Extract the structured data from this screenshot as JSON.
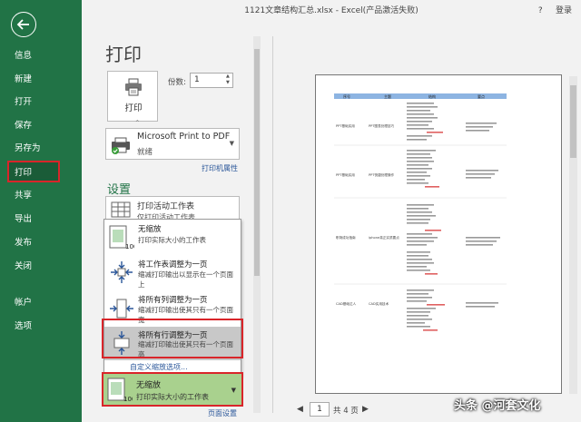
{
  "window": {
    "title": "1121文章结构汇总.xlsx - Excel(产品激活失败)",
    "help": "?",
    "login": "登录"
  },
  "nav": {
    "items": [
      "信息",
      "新建",
      "打开",
      "保存",
      "另存为",
      "打印",
      "共享",
      "导出",
      "发布",
      "关闭",
      "帐户",
      "选项"
    ],
    "active": "打印"
  },
  "print": {
    "title": "打印",
    "button_label": "打印",
    "copies_label": "份数:",
    "copies_value": "1"
  },
  "printer": {
    "name": "Microsoft Print to PDF",
    "status": "就绪",
    "properties_link": "打印机属性"
  },
  "settings": {
    "title": "设置",
    "active_sheets": {
      "label": "打印活动工作表",
      "sub": "仅打印活动工作表"
    },
    "scaling_menu": [
      {
        "title": "无缩放",
        "desc": "打印实际大小的工作表"
      },
      {
        "title": "将工作表调整为一页",
        "desc": "缩减打印输出以显示在一个页面上"
      },
      {
        "title": "将所有列调整为一页",
        "desc": "缩减打印输出使其只有一个页面宽"
      },
      {
        "title": "将所有行调整为一页",
        "desc": "缩减打印输出使其只有一个页面高"
      }
    ],
    "custom_scaling_link": "自定义缩放选项...",
    "selected_scaling": {
      "title": "无缩放",
      "desc": "打印实际大小的工作表"
    },
    "page_setup_link": "页面设置"
  },
  "pager": {
    "current": "1",
    "total": "共 4 页"
  },
  "preview": {
    "headers": [
      "序号",
      "主题",
      "结构",
      "要点"
    ],
    "rows": [
      {
        "subject": "PPT基础实用",
        "theme": "PPT图表处理技巧"
      },
      {
        "subject": "PPT基础实用",
        "theme": "PPT快捷处理操作"
      },
      {
        "subject": "职场成功指南",
        "theme": "iphone真正实质要点"
      },
      {
        "subject": "CAD基础达人",
        "theme": "CAD实用技术"
      }
    ],
    "icons": {
      "printer": "printer-icon",
      "pdf_printer": "pdf-printer-icon"
    }
  },
  "watermark": "头条 @河套文化",
  "colors": {
    "accent": "#217346",
    "active_nav": "#1a5c38",
    "highlight": "#d9252a",
    "selected_fill": "#a9d18e",
    "link": "#2b579a"
  }
}
